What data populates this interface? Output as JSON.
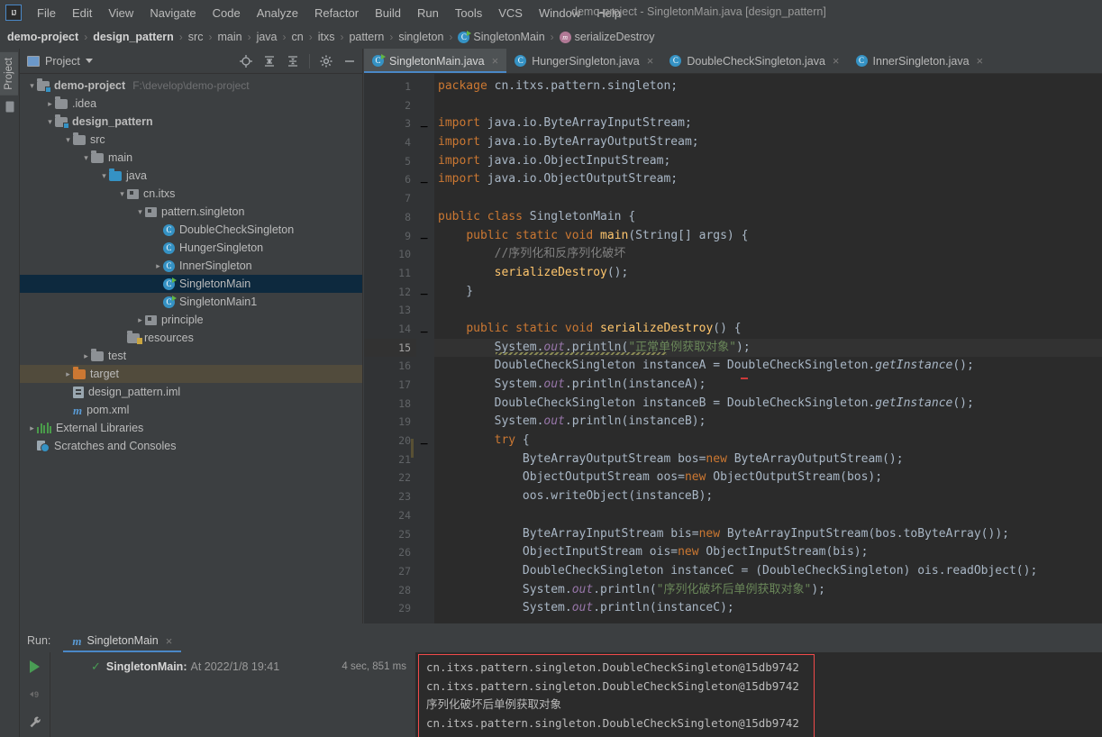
{
  "window": {
    "title": "demo-project - SingletonMain.java [design_pattern]",
    "logo": "IJ"
  },
  "menubar": {
    "items": [
      {
        "label": "File"
      },
      {
        "label": "Edit"
      },
      {
        "label": "View"
      },
      {
        "label": "Navigate"
      },
      {
        "label": "Code"
      },
      {
        "label": "Analyze"
      },
      {
        "label": "Refactor"
      },
      {
        "label": "Build"
      },
      {
        "label": "Run"
      },
      {
        "label": "Tools"
      },
      {
        "label": "VCS"
      },
      {
        "label": "Window"
      },
      {
        "label": "Help"
      }
    ]
  },
  "breadcrumb": {
    "items": [
      {
        "label": "demo-project",
        "bold": true,
        "icon": "none"
      },
      {
        "label": "design_pattern",
        "bold": true,
        "icon": "none"
      },
      {
        "label": "src",
        "icon": "none"
      },
      {
        "label": "main",
        "icon": "none"
      },
      {
        "label": "java",
        "icon": "none"
      },
      {
        "label": "cn",
        "icon": "none"
      },
      {
        "label": "itxs",
        "icon": "none"
      },
      {
        "label": "pattern",
        "icon": "none"
      },
      {
        "label": "singleton",
        "icon": "none"
      },
      {
        "label": "SingletonMain",
        "icon": "class-runnable-icon"
      },
      {
        "label": "serializeDestroy",
        "icon": "method-icon"
      }
    ]
  },
  "left_rail": {
    "tab_label": "Project"
  },
  "project_panel": {
    "title": "Project",
    "toolbar": [
      {
        "name": "locate-icon"
      },
      {
        "name": "expand-all-icon"
      },
      {
        "name": "collapse-all-icon"
      },
      {
        "name": "gear-icon"
      },
      {
        "name": "hide-icon"
      }
    ],
    "tree": [
      {
        "indent": 0,
        "arrow": "v",
        "icon": "module-folder-icon",
        "label": "demo-project",
        "bold": true,
        "path": "F:\\develop\\demo-project"
      },
      {
        "indent": 1,
        "arrow": ">",
        "icon": "folder-icon",
        "label": ".idea"
      },
      {
        "indent": 1,
        "arrow": "v",
        "icon": "module-folder-icon",
        "label": "design_pattern",
        "bold": true
      },
      {
        "indent": 2,
        "arrow": "v",
        "icon": "folder-icon",
        "label": "src"
      },
      {
        "indent": 3,
        "arrow": "v",
        "icon": "folder-icon",
        "label": "main"
      },
      {
        "indent": 4,
        "arrow": "v",
        "icon": "source-folder-icon",
        "label": "java"
      },
      {
        "indent": 5,
        "arrow": "v",
        "icon": "package-icon",
        "label": "cn.itxs"
      },
      {
        "indent": 6,
        "arrow": "v",
        "icon": "package-icon",
        "label": "pattern.singleton"
      },
      {
        "indent": 7,
        "arrow": "",
        "icon": "class-icon",
        "label": "DoubleCheckSingleton"
      },
      {
        "indent": 7,
        "arrow": "",
        "icon": "class-icon",
        "label": "HungerSingleton"
      },
      {
        "indent": 7,
        "arrow": ">",
        "icon": "class-icon",
        "label": "InnerSingleton"
      },
      {
        "indent": 7,
        "arrow": "",
        "icon": "class-runnable-icon",
        "label": "SingletonMain",
        "selected": true
      },
      {
        "indent": 7,
        "arrow": "",
        "icon": "class-runnable-icon",
        "label": "SingletonMain1"
      },
      {
        "indent": 6,
        "arrow": ">",
        "icon": "package-icon",
        "label": "principle"
      },
      {
        "indent": 5,
        "arrow": "",
        "icon": "resources-folder-icon",
        "label": "resources"
      },
      {
        "indent": 3,
        "arrow": ">",
        "icon": "folder-icon",
        "label": "test"
      },
      {
        "indent": 2,
        "arrow": ">",
        "icon": "excluded-folder-icon",
        "label": "target",
        "highlight": true
      },
      {
        "indent": 2,
        "arrow": "",
        "icon": "iml-file-icon",
        "label": "design_pattern.iml"
      },
      {
        "indent": 2,
        "arrow": "",
        "icon": "maven-icon",
        "label": "pom.xml"
      },
      {
        "indent": 0,
        "arrow": ">",
        "icon": "libraries-icon",
        "label": "External Libraries"
      },
      {
        "indent": 0,
        "arrow": "",
        "icon": "scratches-icon",
        "label": "Scratches and Consoles"
      }
    ]
  },
  "editor": {
    "tabs": [
      {
        "label": "SingletonMain.java",
        "active": true,
        "icon": "class-runnable-icon"
      },
      {
        "label": "HungerSingleton.java",
        "active": false,
        "icon": "class-icon"
      },
      {
        "label": "DoubleCheckSingleton.java",
        "active": false,
        "icon": "class-icon"
      },
      {
        "label": "InnerSingleton.java",
        "active": false,
        "icon": "class-icon"
      }
    ],
    "close_glyph": "×",
    "current_line": 15,
    "lines": [
      {
        "n": 1,
        "text": "package cn.itxs.pattern.singleton;"
      },
      {
        "n": 2,
        "text": ""
      },
      {
        "n": 3,
        "text": "import java.io.ByteArrayInputStream;"
      },
      {
        "n": 4,
        "text": "import java.io.ByteArrayOutputStream;"
      },
      {
        "n": 5,
        "text": "import java.io.ObjectInputStream;"
      },
      {
        "n": 6,
        "text": "import java.io.ObjectOutputStream;"
      },
      {
        "n": 7,
        "text": ""
      },
      {
        "n": 8,
        "text": "public class SingletonMain {"
      },
      {
        "n": 9,
        "text": "    public static void main(String[] args) {"
      },
      {
        "n": 10,
        "text": "        //序列化和反序列化破坏"
      },
      {
        "n": 11,
        "text": "        serializeDestroy();"
      },
      {
        "n": 12,
        "text": "    }"
      },
      {
        "n": 13,
        "text": ""
      },
      {
        "n": 14,
        "text": "    public static void serializeDestroy() {"
      },
      {
        "n": 15,
        "text": "        System.out.println(\"正常单例获取对象\");"
      },
      {
        "n": 16,
        "text": "        DoubleCheckSingleton instanceA = DoubleCheckSingleton.getInstance();"
      },
      {
        "n": 17,
        "text": "        System.out.println(instanceA);"
      },
      {
        "n": 18,
        "text": "        DoubleCheckSingleton instanceB = DoubleCheckSingleton.getInstance();"
      },
      {
        "n": 19,
        "text": "        System.out.println(instanceB);"
      },
      {
        "n": 20,
        "text": "        try {"
      },
      {
        "n": 21,
        "text": "            ByteArrayOutputStream bos=new ByteArrayOutputStream();"
      },
      {
        "n": 22,
        "text": "            ObjectOutputStream oos=new ObjectOutputStream(bos);"
      },
      {
        "n": 23,
        "text": "            oos.writeObject(instanceB);"
      },
      {
        "n": 24,
        "text": ""
      },
      {
        "n": 25,
        "text": "            ByteArrayInputStream bis=new ByteArrayInputStream(bos.toByteArray());"
      },
      {
        "n": 26,
        "text": "            ObjectInputStream ois=new ObjectInputStream(bis);"
      },
      {
        "n": 27,
        "text": "            DoubleCheckSingleton instanceC = (DoubleCheckSingleton) ois.readObject();"
      },
      {
        "n": 28,
        "text": "            System.out.println(\"序列化破坏后单例获取对象\");"
      },
      {
        "n": 29,
        "text": "            System.out.println(instanceC);"
      }
    ]
  },
  "run_panel": {
    "label": "Run:",
    "tab": {
      "label": "SingletonMain",
      "icon": "maven-icon"
    },
    "toolbar": [
      {
        "name": "rerun-icon"
      },
      {
        "name": "rerun-failed-icon"
      },
      {
        "name": "settings-wrench-icon"
      }
    ],
    "result": {
      "status_icon": "check-icon",
      "name": "SingletonMain:",
      "at": "At 2022/1/8 19:41",
      "duration": "4 sec, 851 ms"
    },
    "console": {
      "highlight_color": "#f04a4a",
      "lines": [
        "cn.itxs.pattern.singleton.DoubleCheckSingleton@15db9742",
        "cn.itxs.pattern.singleton.DoubleCheckSingleton@15db9742",
        "序列化破坏后单例获取对象",
        "cn.itxs.pattern.singleton.DoubleCheckSingleton@15db9742"
      ]
    }
  },
  "colors": {
    "chrome": "#3c3f41",
    "editor_bg": "#2b2b2b",
    "gutter_bg": "#313335",
    "accent": "#4a88c7",
    "selection": "#0d293e",
    "excluded": "#514b3c",
    "error_box": "#f04a4a",
    "keyword": "#cc7832",
    "string": "#6a8759",
    "field": "#9876aa",
    "method": "#ffc66d",
    "comment": "#808080",
    "text": "#a9b7c6"
  }
}
